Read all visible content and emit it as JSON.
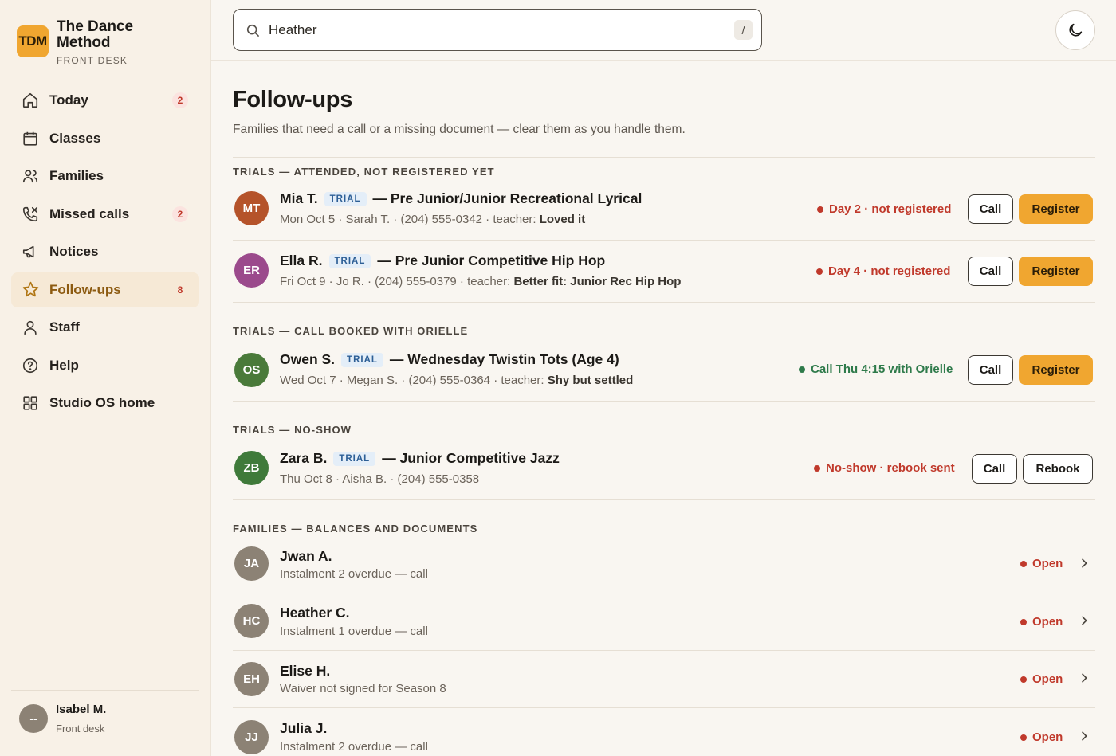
{
  "brand": {
    "logo": "TDM",
    "name": "The Dance Method",
    "sub": "FRONT DESK"
  },
  "nav": [
    {
      "label": "Today",
      "icon": "home-icon",
      "badge": "2"
    },
    {
      "label": "Classes",
      "icon": "calendar-icon",
      "badge": null
    },
    {
      "label": "Families",
      "icon": "users-icon",
      "badge": null
    },
    {
      "label": "Missed calls",
      "icon": "phone-missed-icon",
      "badge": "2"
    },
    {
      "label": "Notices",
      "icon": "megaphone-icon",
      "badge": null
    },
    {
      "label": "Follow-ups",
      "icon": "star-icon",
      "badge": "8",
      "active": true
    },
    {
      "label": "Staff",
      "icon": "person-icon",
      "badge": null
    },
    {
      "label": "Help",
      "icon": "help-circle-icon",
      "badge": null
    },
    {
      "label": "Studio OS home",
      "icon": "grid-icon",
      "badge": null
    }
  ],
  "user": {
    "initials": "--",
    "name": "Isabel M.",
    "role": "Front desk"
  },
  "search": {
    "value": "Heather",
    "shortcut": "/"
  },
  "page": {
    "title": "Follow-ups",
    "subtitle": "Families that need a call or a missing document — clear them as you handle them."
  },
  "sections": {
    "s1": "TRIALS — ATTENDED, NOT REGISTERED YET",
    "s2": "TRIALS — CALL BOOKED WITH ORIELLE",
    "s3": "TRIALS — NO-SHOW",
    "s4": "FAMILIES — BALANCES AND DOCUMENTS"
  },
  "trials": [
    {
      "initials": "MT",
      "color": "#b5532a",
      "name": "Mia T.",
      "tag": "TRIAL",
      "cls": "— Pre Junior/Junior Recreational Lyrical",
      "meta": "Mon Oct 5 · Sarah T. · (204) 555-0342 · teacher: ",
      "note": "Loved it",
      "status": "Day 2 · not registered",
      "call": "Call",
      "action": "Register"
    },
    {
      "initials": "ER",
      "color": "#9b4a8c",
      "name": "Ella R.",
      "tag": "TRIAL",
      "cls": "— Pre Junior Competitive Hip Hop",
      "meta": "Fri Oct 9 · Jo R. · (204) 555-0379 · teacher: ",
      "note": "Better fit: Junior Rec Hip Hop",
      "status": "Day 4 · not registered",
      "call": "Call",
      "action": "Register"
    },
    {
      "initials": "OS",
      "color": "#4a7a3a",
      "name": "Owen S.",
      "tag": "TRIAL",
      "cls": "— Wednesday Twistin Tots (Age 4)",
      "meta": "Wed Oct 7 · Megan S. · (204) 555-0364 · teacher: ",
      "note": "Shy but settled",
      "status": "Call Thu 4:15 with Orielle",
      "call": "Call",
      "action": "Register"
    },
    {
      "initials": "ZB",
      "color": "#3f7a3a",
      "name": "Zara B.",
      "tag": "TRIAL",
      "cls": "— Junior Competitive Jazz",
      "meta": "Thu Oct 8 · Aisha B. · (204) 555-0358",
      "note": "",
      "status": "No-show · rebook sent",
      "call": "Call",
      "action": "Rebook"
    }
  ],
  "families": [
    {
      "initials": "JA",
      "name": "Jwan A.",
      "detail": "Instalment 2 overdue — call",
      "status": "Open"
    },
    {
      "initials": "HC",
      "name": "Heather C.",
      "detail": "Instalment 1 overdue — call",
      "status": "Open"
    },
    {
      "initials": "EH",
      "name": "Elise H.",
      "detail": "Waiver not signed for Season 8",
      "status": "Open"
    },
    {
      "initials": "JJ",
      "name": "Julia J.",
      "detail": "Instalment 2 overdue — call",
      "status": "Open"
    }
  ],
  "colors": {
    "accent": "#f0a630",
    "danger": "#c0392b",
    "success": "#2e7a4a",
    "familyAvatar": "#8c8275"
  }
}
